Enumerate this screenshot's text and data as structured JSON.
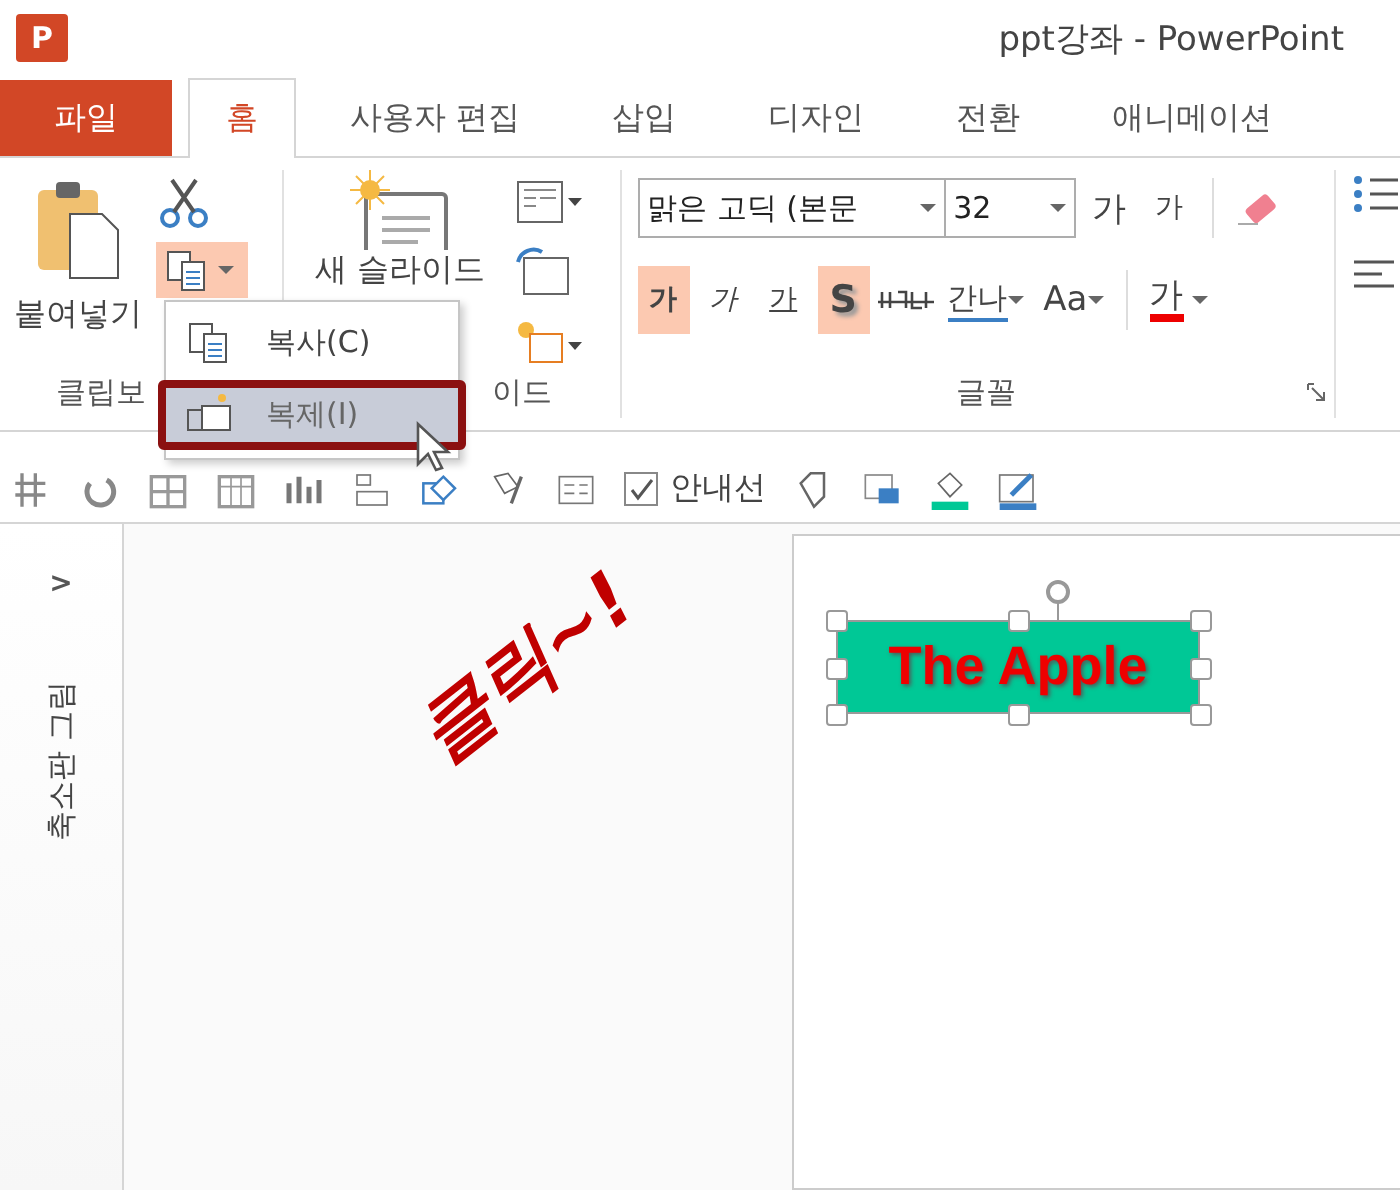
{
  "window": {
    "app_logo": "P",
    "title": "ppt강좌 - PowerPoint"
  },
  "tabs": [
    {
      "label": "파일",
      "kind": "file",
      "selected": false
    },
    {
      "label": "홈",
      "kind": "tab",
      "selected": true
    },
    {
      "label": "사용자 편집",
      "kind": "tab",
      "selected": false
    },
    {
      "label": "삽입",
      "kind": "tab",
      "selected": false
    },
    {
      "label": "디자인",
      "kind": "tab",
      "selected": false
    },
    {
      "label": "전환",
      "kind": "tab",
      "selected": false
    },
    {
      "label": "애니메이션",
      "kind": "tab",
      "selected": false
    }
  ],
  "ribbon": {
    "clipboard": {
      "paste_label": "붙여넣기",
      "copy_selected": true,
      "group_label": "클립보"
    },
    "slides": {
      "new_slide_label": "새 슬라이드",
      "group_label": "이드"
    },
    "font": {
      "font_name": "맑은 고딕 (본문",
      "font_size": "32",
      "grow": "가",
      "shrink": "가",
      "format_buttons": [
        {
          "label": "가",
          "kind": "bold",
          "selected": true
        },
        {
          "label": "가",
          "kind": "italic",
          "selected": false
        },
        {
          "label": "가",
          "kind": "underline",
          "selected": false
        },
        {
          "label": "S",
          "kind": "shadow",
          "selected": true
        }
      ],
      "spacing": "간나",
      "case": "Aa",
      "font_color": "가",
      "group_label": "글꼴"
    }
  },
  "copy_menu": {
    "items": [
      {
        "label": "복사(C)",
        "kind": "copy",
        "selected": false
      },
      {
        "label": "복제(I)",
        "kind": "duplicate",
        "selected": true
      }
    ]
  },
  "toolbar": {
    "guides": {
      "label": "안내선",
      "checked": true
    }
  },
  "thumbnail_pane": {
    "toggle": ">",
    "label": "축소판 그림"
  },
  "annotation": {
    "text": "클릭~!"
  },
  "slide": {
    "shape_text": "The Apple"
  }
}
